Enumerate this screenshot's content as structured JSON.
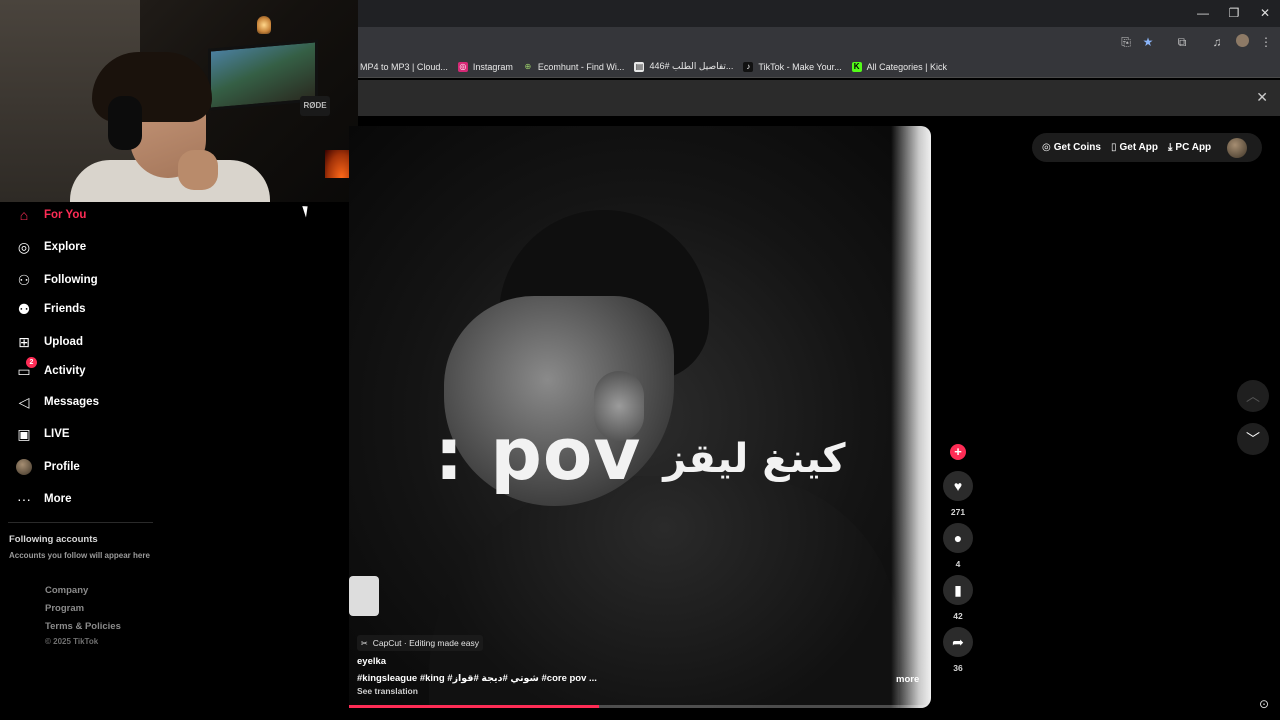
{
  "browser": {
    "window_controls": {
      "minimize": "—",
      "restore": "❐",
      "close": "✕"
    },
    "toolbar_icons": [
      "install-icon",
      "star-icon",
      "extensions-icon",
      "media-icon",
      "profile-icon",
      "menu-icon"
    ],
    "bookmarks": [
      {
        "label": "MP4 to MP3 | Cloud...",
        "icon": "cloudconvert-icon",
        "color": "#35363a"
      },
      {
        "label": "Instagram",
        "icon": "instagram-icon",
        "color": "#d62976"
      },
      {
        "label": "Ecomhunt - Find Wi...",
        "icon": "ecomhunt-icon",
        "color": "#35363a"
      },
      {
        "label": "تفاصيل الطلب #446...",
        "icon": "page-icon",
        "color": "#e8e8e8"
      },
      {
        "label": "TikTok - Make Your...",
        "icon": "tiktok-icon",
        "color": "#111111"
      },
      {
        "label": "All Categories | Kick",
        "icon": "kick-icon",
        "color": "#53fc18"
      }
    ],
    "infobar_close": "✕"
  },
  "sidebar": {
    "items": [
      {
        "label": "For You",
        "icon": "home-icon",
        "glyph": "⌂",
        "active": true
      },
      {
        "label": "Explore",
        "icon": "compass-icon",
        "glyph": "◎",
        "active": false
      },
      {
        "label": "Following",
        "icon": "following-icon",
        "glyph": "⚇",
        "active": false
      },
      {
        "label": "Friends",
        "icon": "friends-icon",
        "glyph": "⚉",
        "active": false
      },
      {
        "label": "Upload",
        "icon": "upload-icon",
        "glyph": "⊞",
        "active": false
      },
      {
        "label": "Activity",
        "icon": "activity-icon",
        "glyph": "▭",
        "active": false,
        "badge": "2"
      },
      {
        "label": "Messages",
        "icon": "messages-icon",
        "glyph": "◁",
        "active": false
      },
      {
        "label": "LIVE",
        "icon": "live-icon",
        "glyph": "▣",
        "active": false
      },
      {
        "label": "Profile",
        "icon": "profile-avatar-icon",
        "glyph": "",
        "active": false
      },
      {
        "label": "More",
        "icon": "more-dots-icon",
        "glyph": "···",
        "active": false
      }
    ],
    "following_title": "Following accounts",
    "following_sub": "Accounts you follow will appear here",
    "footer_links": [
      "Company",
      "Program",
      "Terms & Policies"
    ],
    "copyright": "© 2025 TikTok"
  },
  "video": {
    "overlay_pov": ": pov",
    "overlay_arabic": "كينغ ليقز",
    "capcut": "CapCut · Editing made easy",
    "author": "eyelka",
    "hashtags": "#kingsleague  #king  #شوتي  #ديجة  #قواز  #core  pov ...",
    "see_translation": "See translation",
    "more": "more",
    "progress": 0.43
  },
  "actions": {
    "likes": "271",
    "comments": "4",
    "saves": "42",
    "shares": "36"
  },
  "header": {
    "get_coins": "Get Coins",
    "get_app": "Get App",
    "pc_app": "PC App"
  },
  "colors": {
    "accent": "#fe2c55"
  }
}
